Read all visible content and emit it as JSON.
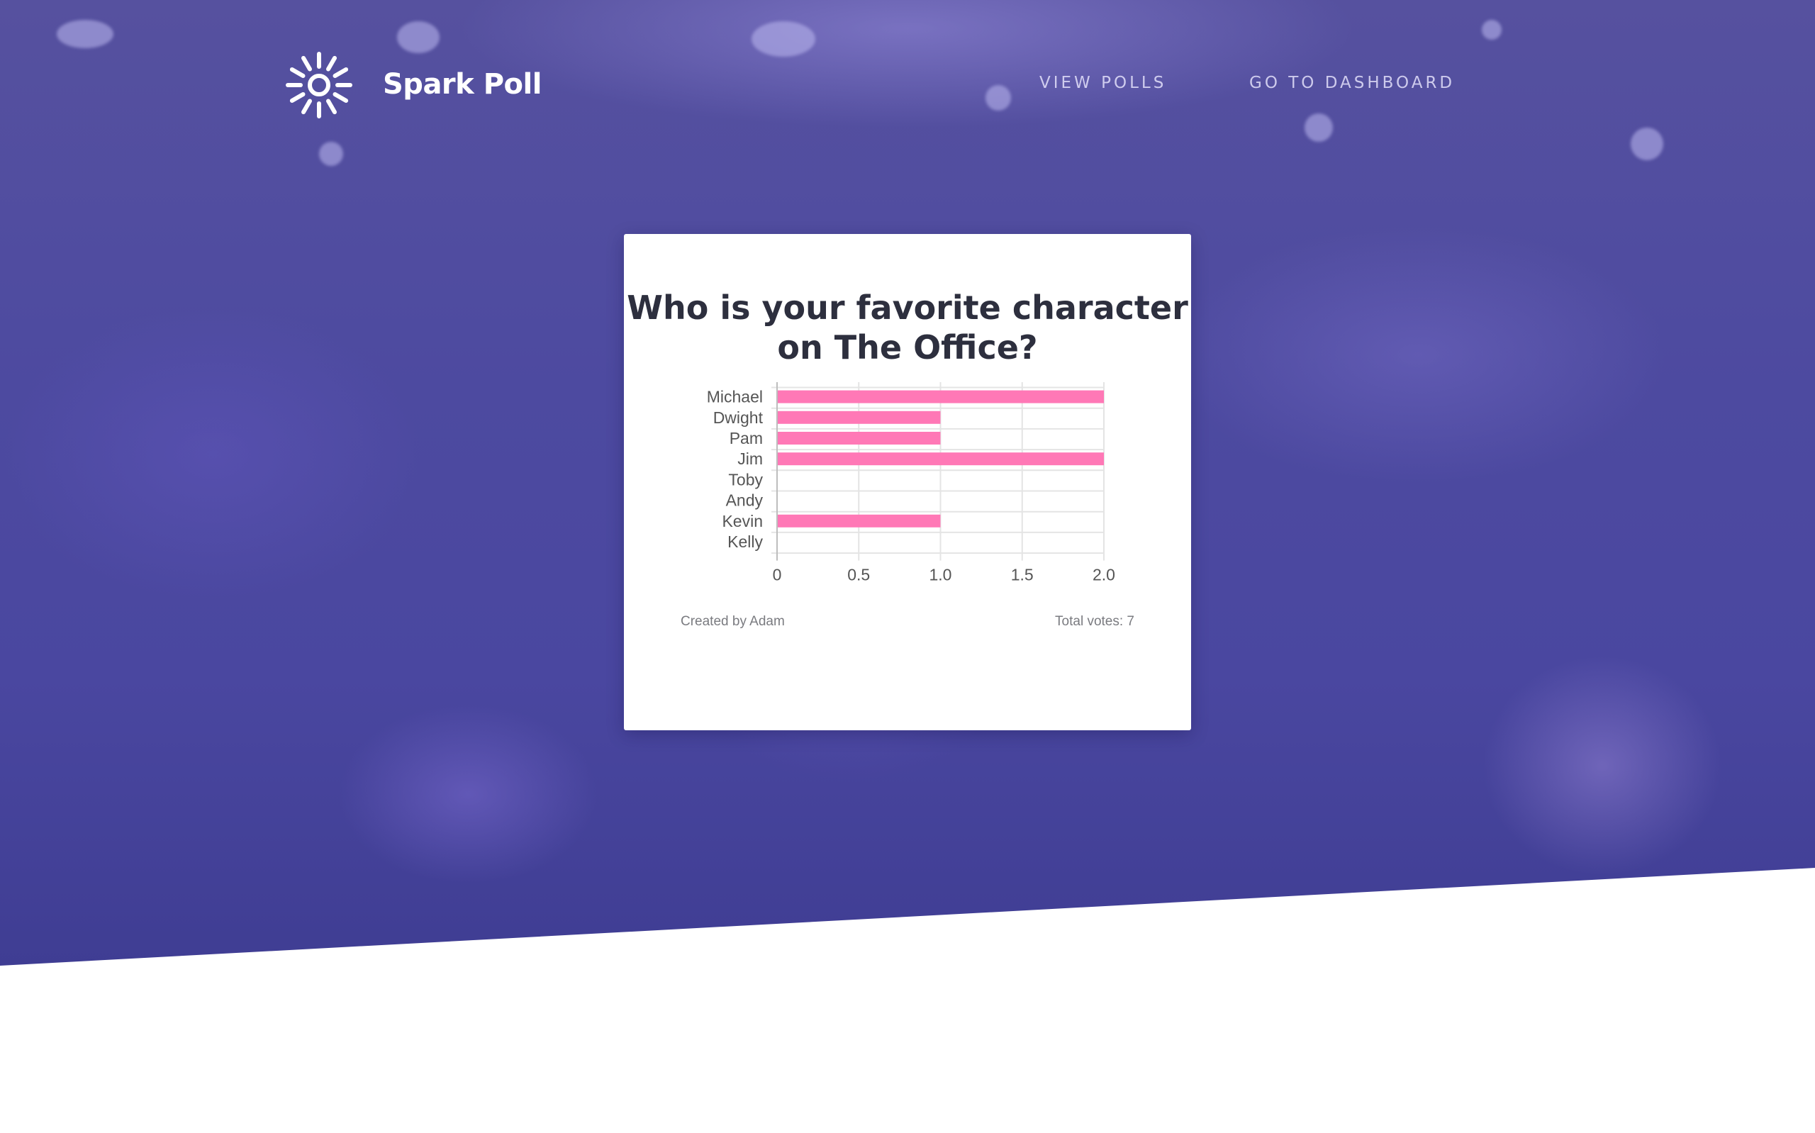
{
  "nav": {
    "brand": "Spark Poll",
    "links": [
      {
        "label": "VIEW POLLS"
      },
      {
        "label": "GO TO DASHBOARD"
      }
    ]
  },
  "poll": {
    "question": "Who is your favorite character on The Office?",
    "created_by": "Created by Adam",
    "total_votes": "Total votes: 7"
  },
  "colors": {
    "hero_overlay": "#4a47a0",
    "bar": "#ff78b6",
    "title_text": "#2d2f3e",
    "nav_text": "#ebe8ff"
  },
  "icons": {
    "logo": "sun-icon"
  },
  "chart_data": {
    "type": "bar",
    "orientation": "horizontal",
    "categories": [
      "Michael",
      "Dwight",
      "Pam",
      "Jim",
      "Toby",
      "Andy",
      "Kevin",
      "Kelly"
    ],
    "values": [
      2,
      1,
      1,
      2,
      0,
      0,
      1,
      0
    ],
    "xlim": [
      0,
      2
    ],
    "xticks": [
      "0",
      "0.5",
      "1.0",
      "1.5",
      "2.0"
    ],
    "xtick_values": [
      0,
      0.5,
      1,
      1.5,
      2
    ],
    "grid": true
  }
}
